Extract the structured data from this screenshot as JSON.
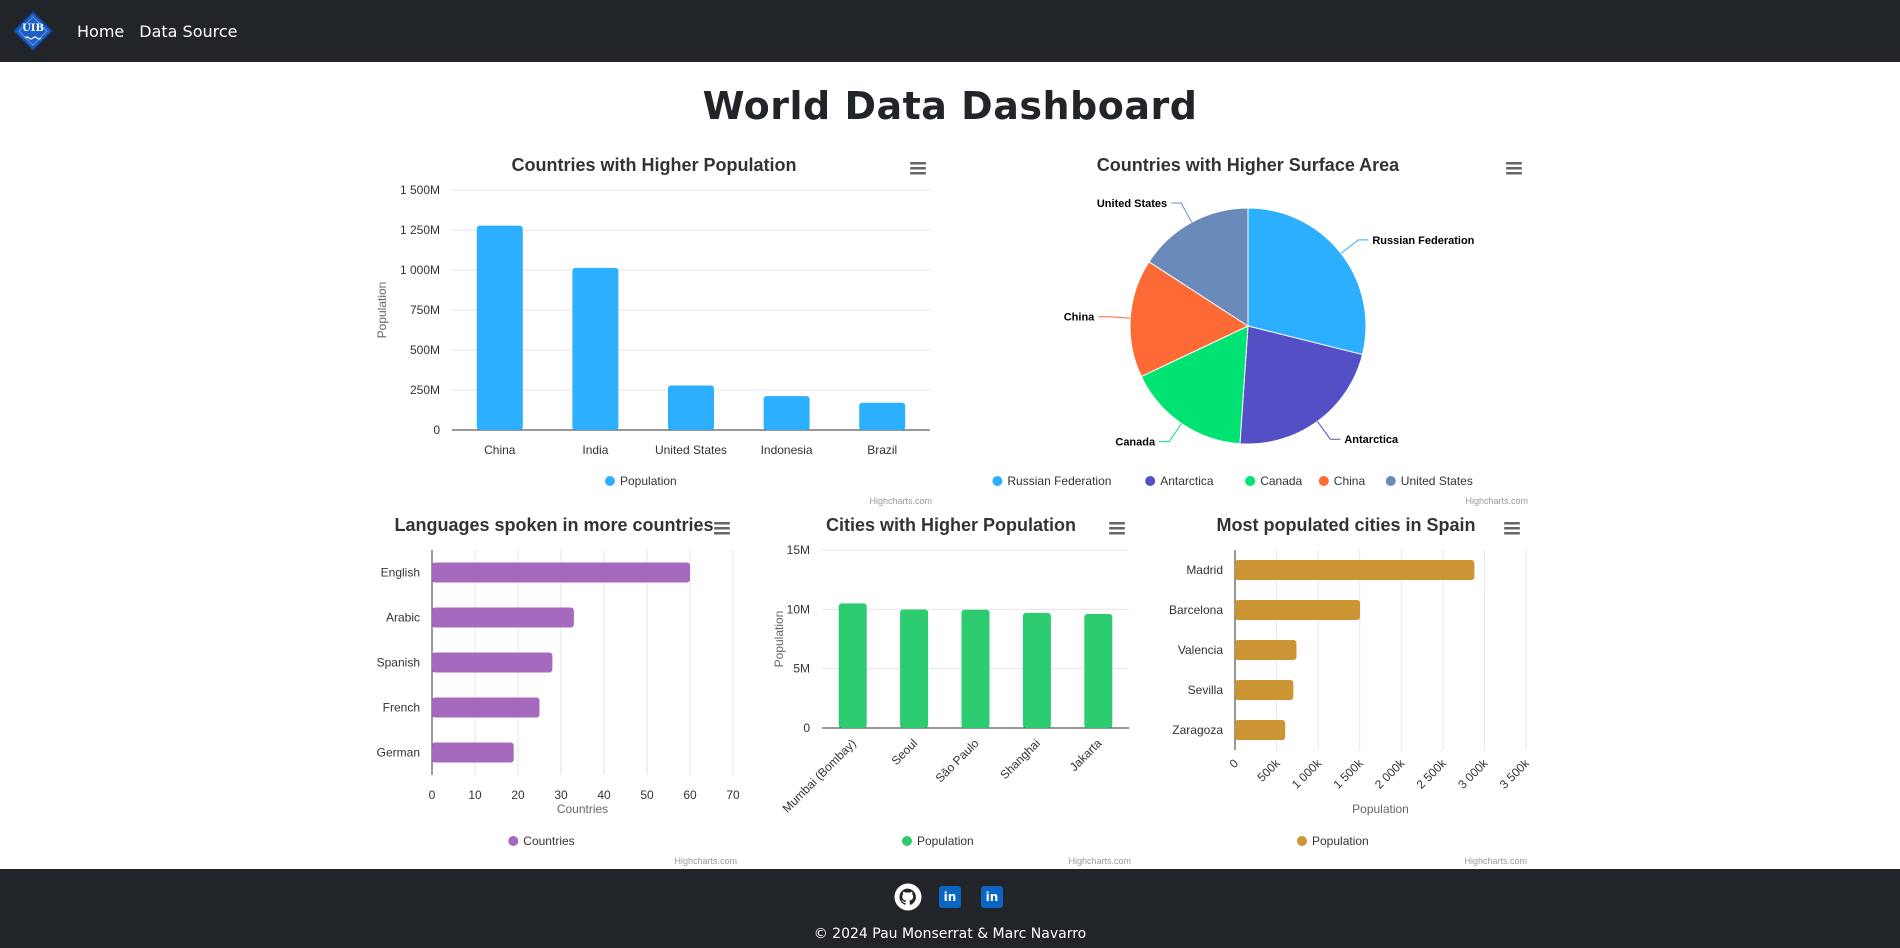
{
  "navbar": {
    "logo_text": "UIB",
    "links": [
      "Home",
      "Data Source"
    ]
  },
  "page": {
    "title": "World Data Dashboard"
  },
  "credits": "Highcharts.com",
  "colors": {
    "population_bar": "#2caffe",
    "pie": [
      "#2caffe",
      "#544fc5",
      "#00e272",
      "#fe6a35",
      "#6b8abc"
    ],
    "languages_bar": "#a569bd",
    "cities_bar": "#2ecc71",
    "spain_bar": "#cc9433"
  },
  "charts": {
    "population": {
      "chart_data": {
        "type": "bar",
        "title": "Countries with Higher Population",
        "categories": [
          "China",
          "India",
          "United States",
          "Indonesia",
          "Brazil"
        ],
        "series": [
          {
            "name": "Population",
            "values": [
              1277558000,
              1013662000,
              278357000,
              212107000,
              170115000
            ]
          }
        ],
        "ylabel": "Population",
        "yticks": [
          "0",
          "250M",
          "500M",
          "750M",
          "1 000M",
          "1 250M",
          "1 500M"
        ],
        "ylim": [
          0,
          1500000000
        ],
        "legend": "bottom",
        "grid": true
      }
    },
    "surface": {
      "chart_data": {
        "type": "pie",
        "title": "Countries with Higher Surface Area",
        "labels": [
          "Russian Federation",
          "Antarctica",
          "Canada",
          "China",
          "United States"
        ],
        "values": [
          17075400,
          13120000,
          9970610,
          9572900,
          9363520
        ],
        "legend": "bottom"
      }
    },
    "languages": {
      "chart_data": {
        "type": "bar",
        "orientation": "horizontal",
        "title": "Languages spoken in more countries",
        "categories": [
          "English",
          "Arabic",
          "Spanish",
          "French",
          "German"
        ],
        "series": [
          {
            "name": "Countries",
            "values": [
              60,
              33,
              28,
              25,
              19
            ]
          }
        ],
        "xlabel": "Countries",
        "xticks": [
          "0",
          "10",
          "20",
          "30",
          "40",
          "50",
          "60",
          "70"
        ],
        "xlim": [
          0,
          70
        ],
        "legend": "bottom",
        "grid": true
      }
    },
    "cities": {
      "chart_data": {
        "type": "bar",
        "title": "Cities with Higher Population",
        "categories": [
          "Mumbai (Bombay)",
          "Seoul",
          "São Paulo",
          "Shanghai",
          "Jakarta"
        ],
        "series": [
          {
            "name": "Population",
            "values": [
              10500000,
              9981619,
              9968485,
              9696300,
              9604900
            ]
          }
        ],
        "ylabel": "Population",
        "yticks": [
          "0",
          "5M",
          "10M",
          "15M"
        ],
        "ylim": [
          0,
          15000000
        ],
        "legend": "bottom",
        "grid": true
      }
    },
    "spain": {
      "chart_data": {
        "type": "bar",
        "orientation": "horizontal",
        "title": "Most populated cities in Spain",
        "categories": [
          "Madrid",
          "Barcelona",
          "Valencia",
          "Sevilla",
          "Zaragoza"
        ],
        "series": [
          {
            "name": "Population",
            "values": [
              2879052,
              1503451,
              739412,
              701927,
              603367
            ]
          }
        ],
        "xlabel": "Population",
        "xticks": [
          "0",
          "500k",
          "1 000k",
          "1 500k",
          "2 000k",
          "2 500k",
          "3 000k",
          "3 500k"
        ],
        "xlim": [
          0,
          3500000
        ],
        "legend": "bottom",
        "grid": true
      }
    }
  },
  "footer": {
    "icons": [
      "github-icon",
      "linkedin-icon",
      "linkedin-icon"
    ],
    "linkedin_text": "in",
    "copyright": "© 2024 Pau Monserrat & Marc Navarro"
  }
}
